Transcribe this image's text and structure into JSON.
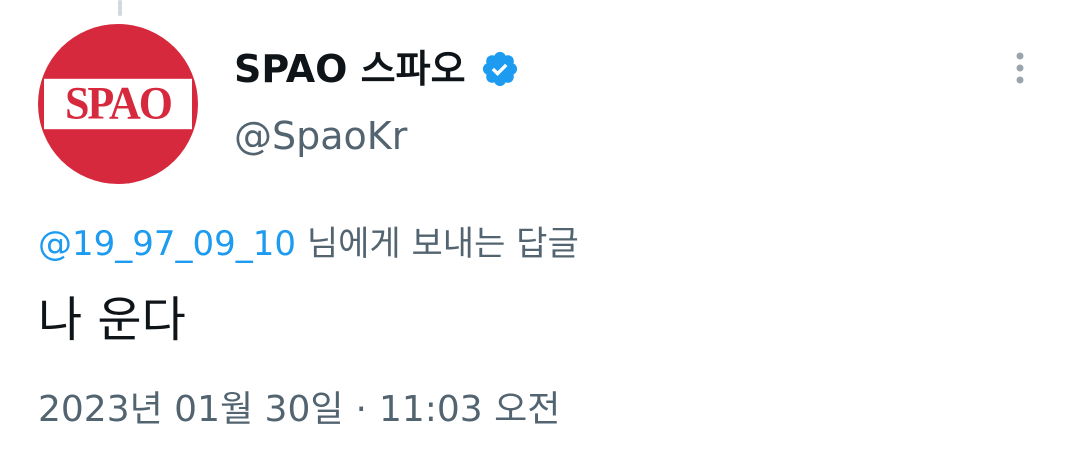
{
  "profile": {
    "avatar_text": "SPAO",
    "display_name": "SPAO 스파오",
    "handle": "@SpaoKr",
    "verified_icon": "verified-badge-icon"
  },
  "reply": {
    "mention": "@19_97_09_10",
    "suffix": " 님에게 보내는 답글"
  },
  "tweet": {
    "text": "나 운다"
  },
  "timestamp": {
    "date": "2023년 01월 30일",
    "separator": "·",
    "time": "11:03 오전"
  },
  "colors": {
    "brand_red": "#d7293e",
    "verified_blue": "#1d9bf0",
    "muted_text": "#536471",
    "primary_text": "#0f1419"
  },
  "icons": {
    "more": "more-vertical-icon"
  }
}
